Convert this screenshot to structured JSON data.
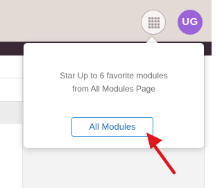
{
  "header": {
    "apps_icon": "grid-dots-icon",
    "avatar_initials": "UG",
    "avatar_color": "#9a63d8",
    "bar_color": "#e3dad6",
    "nav_color": "#3a2837"
  },
  "popover": {
    "message_line1": "Star Up to 6 favorite modules",
    "message_line2": "from All Modules Page",
    "button_label": "All Modules",
    "button_color": "#2d8fd6"
  },
  "annotation": {
    "arrow_icon": "red-arrow-icon",
    "arrow_color": "#e0161b"
  }
}
